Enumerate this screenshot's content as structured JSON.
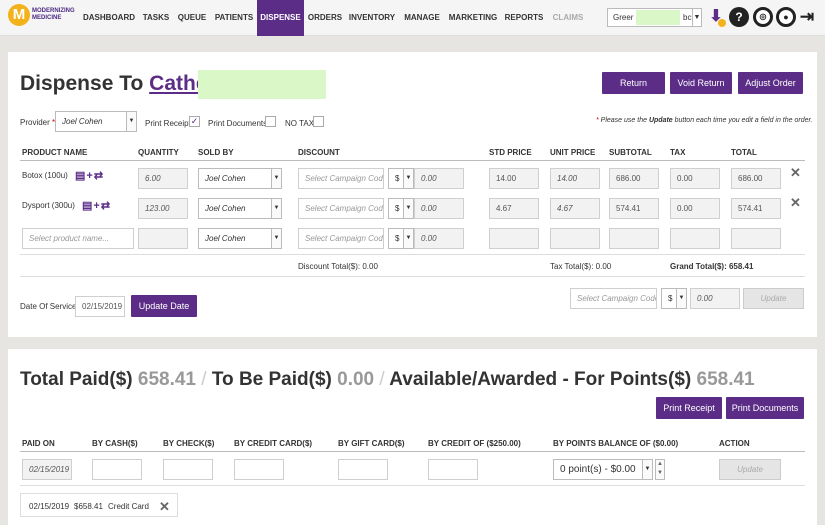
{
  "nav": {
    "logo_letter": "M",
    "logo_text": "MODERNIZING MEDICINE",
    "items": [
      "DASHBOARD",
      "TASKS",
      "QUEUE",
      "PATIENTS",
      "DISPENSE",
      "ORDERS",
      "INVENTORY",
      "MANAGE",
      "MARKETING",
      "REPORTS",
      "CLAIMS"
    ],
    "active": "DISPENSE",
    "search_value": "Greer",
    "search_suffix": "bc",
    "icons": [
      "download-icon",
      "help-icon",
      "support-icon",
      "user-icon",
      "logout-icon"
    ]
  },
  "dispense": {
    "title_prefix": "Dispense To",
    "patient_name": "Catherii",
    "buttons": {
      "return": "Return",
      "void_return": "Void Return",
      "adjust_order": "Adjust Order"
    },
    "provider_label": "Provider",
    "provider_value": "Joel Cohen",
    "print_receipt": "Print Receipt",
    "print_documents": "Print Documents",
    "no_tax": "NO TAX",
    "notice_pre": "Please use the",
    "notice_bold": "Update",
    "notice_post": "button each time you edit a field in the order.",
    "columns": [
      "PRODUCT NAME",
      "QUANTITY",
      "SOLD BY",
      "DISCOUNT",
      "STD PRICE",
      "UNIT PRICE",
      "SUBTOTAL",
      "TAX",
      "TOTAL"
    ],
    "rows": [
      {
        "product": "Botox (100u)",
        "qty": "6.00",
        "sold_by": "Joel Cohen",
        "campaign_placeholder": "Select Campaign Code",
        "disc_type": "$",
        "disc_value": "0.00",
        "std_price": "14.00",
        "unit_price": "14.00",
        "subtotal": "686.00",
        "tax": "0.00",
        "total": "686.00"
      },
      {
        "product": "Dysport (300u)",
        "qty": "123.00",
        "sold_by": "Joel Cohen",
        "campaign_placeholder": "Select Campaign Code",
        "disc_type": "$",
        "disc_value": "0.00",
        "std_price": "4.67",
        "unit_price": "4.67",
        "subtotal": "574.41",
        "tax": "0.00",
        "total": "574.41"
      }
    ],
    "new_row": {
      "product_placeholder": "Select product name...",
      "sold_by": "Joel Cohen",
      "campaign_placeholder": "Select Campaign Code",
      "disc_type": "$",
      "disc_value": "0.00"
    },
    "discount_total": "Discount Total($): 0.00",
    "tax_total": "Tax Total($): 0.00",
    "grand_total": "Grand Total($): 658.41",
    "date_label": "Date Of Service",
    "date_value": "02/15/2019",
    "update_date": "Update Date",
    "order_campaign_placeholder": "Select Campaign Code",
    "order_disc_type": "$",
    "order_disc_value": "0.00",
    "update": "Update"
  },
  "payment": {
    "total_paid_label": "Total Paid($)",
    "total_paid": "658.41",
    "sep": "/",
    "to_be_paid_label": "To Be Paid($)",
    "to_be_paid": "0.00",
    "points_label": "Available/Awarded - For Points($)",
    "points": "658.41",
    "print_receipt": "Print Receipt",
    "print_documents": "Print Documents",
    "columns": [
      "PAID ON",
      "BY CASH($)",
      "BY CHECK($)",
      "BY CREDIT CARD($)",
      "BY GIFT CARD($)",
      "BY CREDIT OF ($250.00)",
      "BY POINTS BALANCE OF ($0.00)",
      "ACTION"
    ],
    "paid_on": "02/15/2019",
    "points_select": "0 point(s) - $0.00",
    "update": "Update",
    "history": {
      "date": "02/15/2019",
      "amount": "$658.41",
      "method": "Credit Card"
    }
  },
  "colors": {
    "brand": "#5b2d86",
    "logo": "#f3b21b",
    "highlight": "#d9f7c7"
  }
}
